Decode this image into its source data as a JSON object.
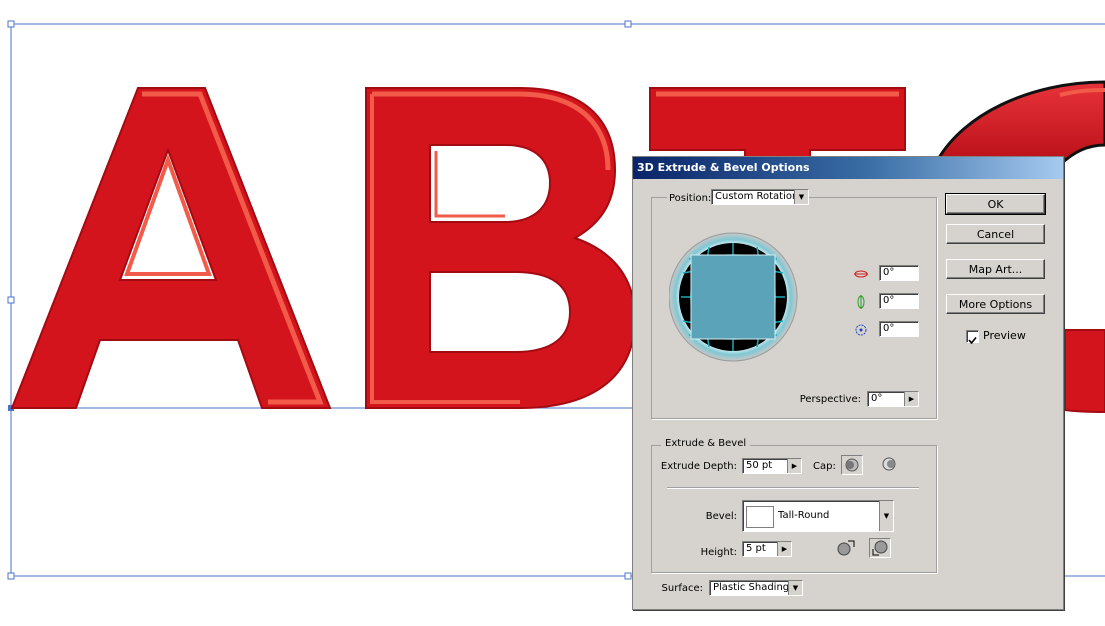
{
  "canvas": {
    "text": "ABTC",
    "letter_fill": "#d3141d",
    "letter_highlight": "#f25a4a",
    "guide_color": "#4a74c9"
  },
  "dialog": {
    "title": "3D Extrude & Bevel Options",
    "position_label": "Position:",
    "position_value": "Custom Rotation",
    "rot_x": "0°",
    "rot_y": "0°",
    "rot_z": "0°",
    "perspective_label": "Perspective:",
    "perspective_value": "0°",
    "extrude_section": "Extrude & Bevel",
    "extrude_depth_label": "Extrude Depth:",
    "extrude_depth_value": "50 pt",
    "cap_label": "Cap:",
    "bevel_label": "Bevel:",
    "bevel_value": "Tall-Round",
    "height_label": "Height:",
    "height_value": "5 pt",
    "surface_label": "Surface:",
    "surface_value": "Plastic Shading",
    "ok": "OK",
    "cancel": "Cancel",
    "map_art": "Map Art...",
    "more_options": "More Options",
    "preview_label": "Preview",
    "preview_checked": true
  },
  "colors": {
    "dialog_bg": "#d6d3ce",
    "title_start": "#0a246a",
    "title_end": "#a6caf0",
    "cube_face": "#5ba3b8",
    "track_grid": "#1aa9b8"
  }
}
